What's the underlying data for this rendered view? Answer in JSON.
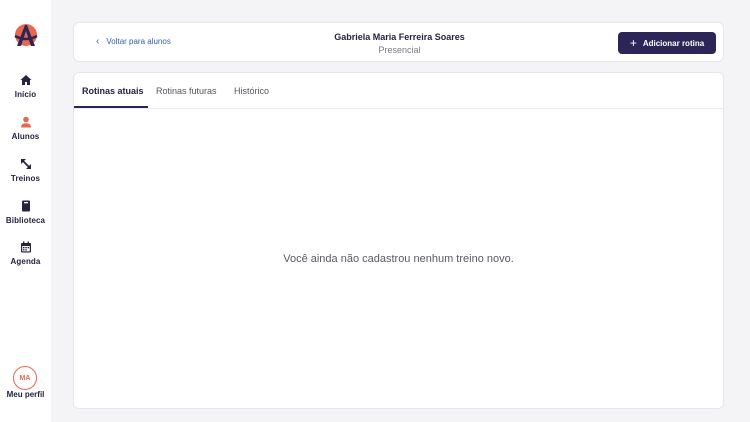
{
  "sidebar": {
    "logo": "logo-icon",
    "items": [
      {
        "label": "Início",
        "icon": "home-icon"
      },
      {
        "label": "Alunos",
        "icon": "person-icon"
      },
      {
        "label": "Treinos",
        "icon": "arrows-diagonal-icon"
      },
      {
        "label": "Biblioteca",
        "icon": "book-icon"
      },
      {
        "label": "Agenda",
        "icon": "calendar-icon"
      }
    ],
    "profile": {
      "initials": "MA",
      "label": "Meu perfil"
    }
  },
  "header": {
    "back_label": "Voltar para alunos",
    "student_name": "Gabriela Maria Ferreira Soares",
    "student_mode": "Presencial",
    "add_button_label": "Adicionar rotina"
  },
  "tabs": [
    {
      "label": "Rotinas atuais",
      "active": true
    },
    {
      "label": "Rotinas futuras",
      "active": false
    },
    {
      "label": "Histórico",
      "active": false
    }
  ],
  "empty_state": "Você ainda não cadastrou nenhum treino novo.",
  "colors": {
    "accent": "#2b2657",
    "brand": "#e8674d",
    "link": "#3a5ea8"
  }
}
